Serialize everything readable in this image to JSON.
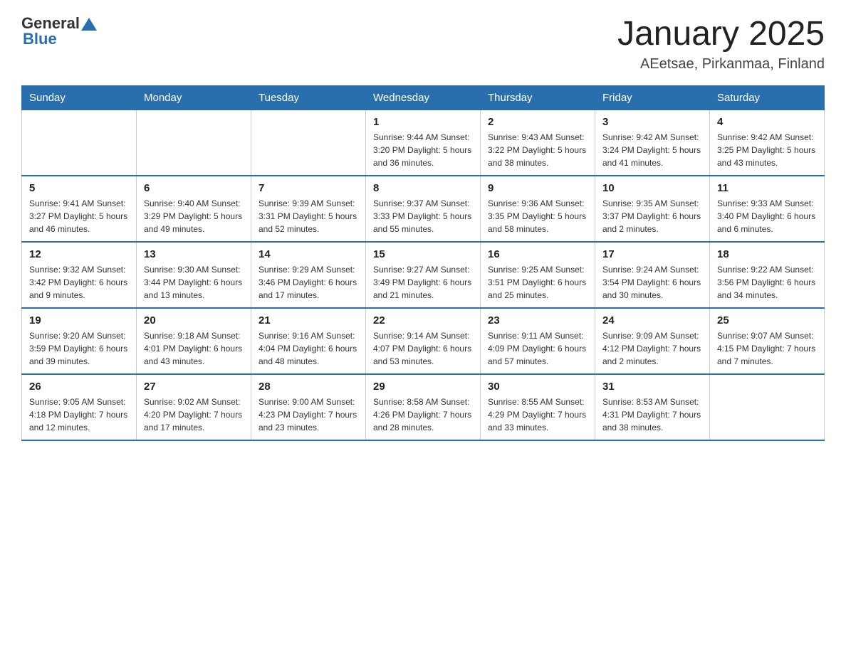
{
  "header": {
    "logo_general": "General",
    "logo_blue": "Blue",
    "title": "January 2025",
    "subtitle": "AEetsae, Pirkanmaa, Finland"
  },
  "days_of_week": [
    "Sunday",
    "Monday",
    "Tuesday",
    "Wednesday",
    "Thursday",
    "Friday",
    "Saturday"
  ],
  "weeks": [
    [
      {
        "day": "",
        "info": ""
      },
      {
        "day": "",
        "info": ""
      },
      {
        "day": "",
        "info": ""
      },
      {
        "day": "1",
        "info": "Sunrise: 9:44 AM\nSunset: 3:20 PM\nDaylight: 5 hours\nand 36 minutes."
      },
      {
        "day": "2",
        "info": "Sunrise: 9:43 AM\nSunset: 3:22 PM\nDaylight: 5 hours\nand 38 minutes."
      },
      {
        "day": "3",
        "info": "Sunrise: 9:42 AM\nSunset: 3:24 PM\nDaylight: 5 hours\nand 41 minutes."
      },
      {
        "day": "4",
        "info": "Sunrise: 9:42 AM\nSunset: 3:25 PM\nDaylight: 5 hours\nand 43 minutes."
      }
    ],
    [
      {
        "day": "5",
        "info": "Sunrise: 9:41 AM\nSunset: 3:27 PM\nDaylight: 5 hours\nand 46 minutes."
      },
      {
        "day": "6",
        "info": "Sunrise: 9:40 AM\nSunset: 3:29 PM\nDaylight: 5 hours\nand 49 minutes."
      },
      {
        "day": "7",
        "info": "Sunrise: 9:39 AM\nSunset: 3:31 PM\nDaylight: 5 hours\nand 52 minutes."
      },
      {
        "day": "8",
        "info": "Sunrise: 9:37 AM\nSunset: 3:33 PM\nDaylight: 5 hours\nand 55 minutes."
      },
      {
        "day": "9",
        "info": "Sunrise: 9:36 AM\nSunset: 3:35 PM\nDaylight: 5 hours\nand 58 minutes."
      },
      {
        "day": "10",
        "info": "Sunrise: 9:35 AM\nSunset: 3:37 PM\nDaylight: 6 hours\nand 2 minutes."
      },
      {
        "day": "11",
        "info": "Sunrise: 9:33 AM\nSunset: 3:40 PM\nDaylight: 6 hours\nand 6 minutes."
      }
    ],
    [
      {
        "day": "12",
        "info": "Sunrise: 9:32 AM\nSunset: 3:42 PM\nDaylight: 6 hours\nand 9 minutes."
      },
      {
        "day": "13",
        "info": "Sunrise: 9:30 AM\nSunset: 3:44 PM\nDaylight: 6 hours\nand 13 minutes."
      },
      {
        "day": "14",
        "info": "Sunrise: 9:29 AM\nSunset: 3:46 PM\nDaylight: 6 hours\nand 17 minutes."
      },
      {
        "day": "15",
        "info": "Sunrise: 9:27 AM\nSunset: 3:49 PM\nDaylight: 6 hours\nand 21 minutes."
      },
      {
        "day": "16",
        "info": "Sunrise: 9:25 AM\nSunset: 3:51 PM\nDaylight: 6 hours\nand 25 minutes."
      },
      {
        "day": "17",
        "info": "Sunrise: 9:24 AM\nSunset: 3:54 PM\nDaylight: 6 hours\nand 30 minutes."
      },
      {
        "day": "18",
        "info": "Sunrise: 9:22 AM\nSunset: 3:56 PM\nDaylight: 6 hours\nand 34 minutes."
      }
    ],
    [
      {
        "day": "19",
        "info": "Sunrise: 9:20 AM\nSunset: 3:59 PM\nDaylight: 6 hours\nand 39 minutes."
      },
      {
        "day": "20",
        "info": "Sunrise: 9:18 AM\nSunset: 4:01 PM\nDaylight: 6 hours\nand 43 minutes."
      },
      {
        "day": "21",
        "info": "Sunrise: 9:16 AM\nSunset: 4:04 PM\nDaylight: 6 hours\nand 48 minutes."
      },
      {
        "day": "22",
        "info": "Sunrise: 9:14 AM\nSunset: 4:07 PM\nDaylight: 6 hours\nand 53 minutes."
      },
      {
        "day": "23",
        "info": "Sunrise: 9:11 AM\nSunset: 4:09 PM\nDaylight: 6 hours\nand 57 minutes."
      },
      {
        "day": "24",
        "info": "Sunrise: 9:09 AM\nSunset: 4:12 PM\nDaylight: 7 hours\nand 2 minutes."
      },
      {
        "day": "25",
        "info": "Sunrise: 9:07 AM\nSunset: 4:15 PM\nDaylight: 7 hours\nand 7 minutes."
      }
    ],
    [
      {
        "day": "26",
        "info": "Sunrise: 9:05 AM\nSunset: 4:18 PM\nDaylight: 7 hours\nand 12 minutes."
      },
      {
        "day": "27",
        "info": "Sunrise: 9:02 AM\nSunset: 4:20 PM\nDaylight: 7 hours\nand 17 minutes."
      },
      {
        "day": "28",
        "info": "Sunrise: 9:00 AM\nSunset: 4:23 PM\nDaylight: 7 hours\nand 23 minutes."
      },
      {
        "day": "29",
        "info": "Sunrise: 8:58 AM\nSunset: 4:26 PM\nDaylight: 7 hours\nand 28 minutes."
      },
      {
        "day": "30",
        "info": "Sunrise: 8:55 AM\nSunset: 4:29 PM\nDaylight: 7 hours\nand 33 minutes."
      },
      {
        "day": "31",
        "info": "Sunrise: 8:53 AM\nSunset: 4:31 PM\nDaylight: 7 hours\nand 38 minutes."
      },
      {
        "day": "",
        "info": ""
      }
    ]
  ]
}
